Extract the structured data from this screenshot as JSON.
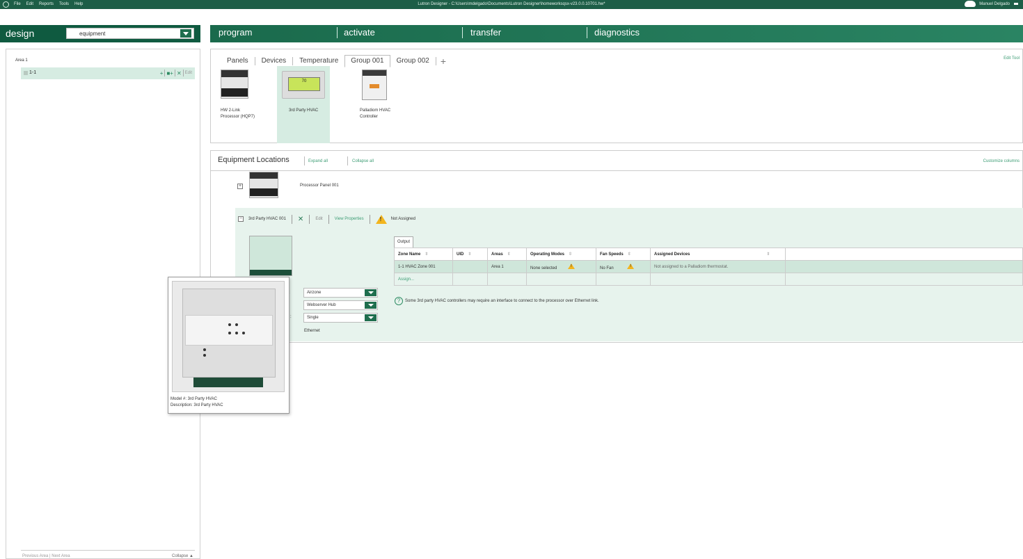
{
  "titlebar": {
    "menu": [
      "File",
      "Edit",
      "Reports",
      "Tools",
      "Help"
    ],
    "title": "Lutron Designer - C:\\Users\\mdelgado\\Documents\\Lutron Designer\\homeworksqsx-v23.0.0.10701.hw*",
    "user": "Manuel Delgado"
  },
  "nav": {
    "design": "design",
    "mode_select": "equipment",
    "tabs": [
      "program",
      "activate",
      "transfer",
      "diagnostics"
    ]
  },
  "sidebar": {
    "area": "Area 1",
    "item": "1-1",
    "edit": "Edit",
    "footer_left": "Previous Area  |  Next Area",
    "footer_right": "Collapse ▲"
  },
  "device_tabs": {
    "tabs": [
      "Panels",
      "Devices",
      "Temperature",
      "Group 001",
      "Group 002"
    ],
    "active": "Group 001",
    "edit_tool": "Edit Tool"
  },
  "devices": [
    {
      "label_l1": "HW 2-Link",
      "label_l2": "Processor (HQP7)"
    },
    {
      "label_l1": "3rd Party HVAC",
      "label_l2": "",
      "screen": "70"
    },
    {
      "label_l1": "Palladiom HVAC",
      "label_l2": "Controller"
    }
  ],
  "equipment": {
    "title": "Equipment Locations",
    "expand_all": "Expand all",
    "collapse_all": "Collapse all",
    "customize": "Customize columns",
    "processor": "Processor Panel 001",
    "hvac": {
      "name": "3rd Party HVAC 001",
      "delete": "✕",
      "edit": "Edit",
      "view_properties": "View Properties",
      "status": "Not Assigned",
      "properties": [
        {
          "label": ":",
          "value": "Airzone"
        },
        {
          "label": "",
          "value": "Webserver Hub"
        },
        {
          "label": ":",
          "value": "Single"
        },
        {
          "label": "",
          "value": "Ethernet"
        }
      ]
    },
    "output_tab": "Output",
    "columns": [
      "Zone Name",
      "UID",
      "Areas",
      "Operating Modes",
      "Fan Speeds",
      "Assigned Devices"
    ],
    "rows": [
      {
        "zone": "1-1 HVAC Zone 001",
        "uid": "",
        "areas": "Area 1",
        "modes": "None selected",
        "fan": "No Fan",
        "assigned": "Not assigned to a Palladiom thermostat."
      }
    ],
    "assign": "Assign...",
    "note": "Some 3rd party HVAC controllers may require an interface to connect to the processor over Ethernet link."
  },
  "tooltip": {
    "model": "Model #: 3rd Party HVAC",
    "description": "Description: 3rd Party HVAC"
  }
}
